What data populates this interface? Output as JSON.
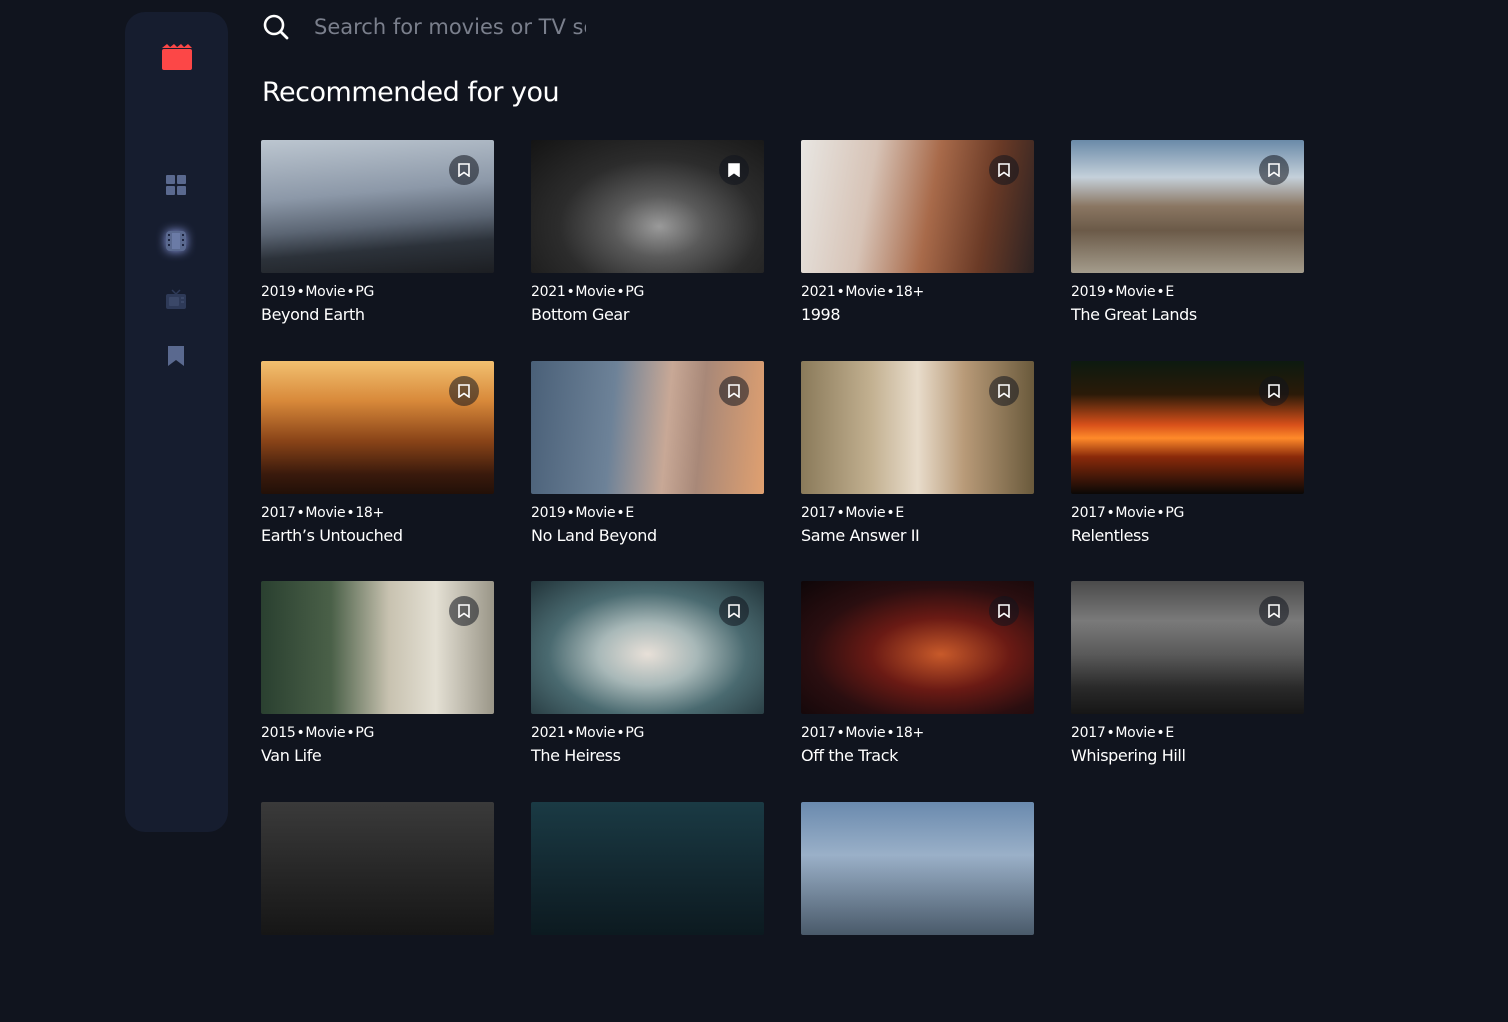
{
  "search": {
    "placeholder": "Search for movies or TV series"
  },
  "section_title": "Recommended for you",
  "nav": [
    {
      "icon": "home-grid-icon",
      "active": false
    },
    {
      "icon": "movies-film-icon",
      "active": true
    },
    {
      "icon": "tv-series-icon",
      "active": false
    },
    {
      "icon": "bookmark-icon",
      "active": false
    }
  ],
  "colors": {
    "background": "#10141e",
    "sidebar": "#161d2f",
    "accent": "#fc4747",
    "muted": "#5a698f"
  },
  "cards": [
    {
      "year": "2019",
      "category": "Movie",
      "rating": "PG",
      "title": "Beyond Earth",
      "bookmarked": false
    },
    {
      "year": "2021",
      "category": "Movie",
      "rating": "PG",
      "title": "Bottom Gear",
      "bookmarked": true
    },
    {
      "year": "2021",
      "category": "Movie",
      "rating": "18+",
      "title": "1998",
      "bookmarked": false
    },
    {
      "year": "2019",
      "category": "Movie",
      "rating": "E",
      "title": "The Great Lands",
      "bookmarked": false
    },
    {
      "year": "2017",
      "category": "Movie",
      "rating": "18+",
      "title": "Earth’s Untouched",
      "bookmarked": false
    },
    {
      "year": "2019",
      "category": "Movie",
      "rating": "E",
      "title": "No Land Beyond",
      "bookmarked": false
    },
    {
      "year": "2017",
      "category": "Movie",
      "rating": "E",
      "title": "Same Answer II",
      "bookmarked": false
    },
    {
      "year": "2017",
      "category": "Movie",
      "rating": "PG",
      "title": "Relentless",
      "bookmarked": false
    },
    {
      "year": "2015",
      "category": "Movie",
      "rating": "PG",
      "title": "Van Life",
      "bookmarked": false
    },
    {
      "year": "2021",
      "category": "Movie",
      "rating": "PG",
      "title": "The Heiress",
      "bookmarked": false
    },
    {
      "year": "2017",
      "category": "Movie",
      "rating": "18+",
      "title": "Off the Track",
      "bookmarked": false
    },
    {
      "year": "2017",
      "category": "Movie",
      "rating": "E",
      "title": "Whispering Hill",
      "bookmarked": false
    },
    {
      "year": "",
      "category": "",
      "rating": "",
      "title": "",
      "bookmarked": false
    },
    {
      "year": "",
      "category": "",
      "rating": "",
      "title": "",
      "bookmarked": false
    },
    {
      "year": "",
      "category": "",
      "rating": "",
      "title": "",
      "bookmarked": false
    }
  ]
}
